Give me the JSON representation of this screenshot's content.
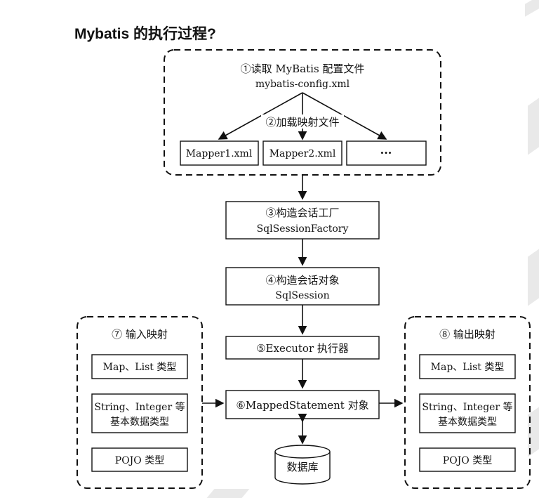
{
  "page_title": "Mybatis 的执行过程?",
  "config": {
    "step1_title": "①读取 MyBatis 配置文件",
    "step1_file": "mybatis-config.xml",
    "step2_title": "②加载映射文件",
    "mappers": [
      "Mapper1.xml",
      "Mapper2.xml",
      "···"
    ]
  },
  "steps": {
    "step3_title": "③构造会话工厂",
    "step3_sub": "SqlSessionFactory",
    "step4_title": "④构造会话对象",
    "step4_sub": "SqlSession",
    "step5": "⑤Executor 执行器",
    "step6": "⑥MappedStatement 对象",
    "database": "数据库"
  },
  "input_mapping": {
    "title": "⑦ 输入映射",
    "items": [
      "Map、List 类型",
      "String、Integer 等",
      "基本数据类型",
      "POJO 类型"
    ]
  },
  "output_mapping": {
    "title": "⑧ 输出映射",
    "items": [
      "Map、List 类型",
      "String、Integer 等",
      "基本数据类型",
      "POJO 类型"
    ]
  }
}
